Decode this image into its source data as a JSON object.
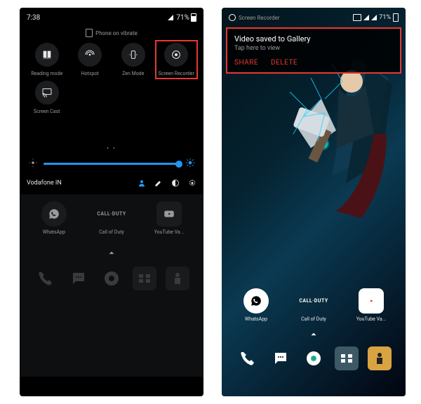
{
  "left": {
    "status": {
      "time": "7:38",
      "battery_pct": "71%"
    },
    "vibrate_label": "Phone on vibrate",
    "tiles": [
      {
        "label": "Reading mode",
        "icon": "book"
      },
      {
        "label": "Hotspot",
        "icon": "hotspot"
      },
      {
        "label": "Zen Mode",
        "icon": "zen"
      },
      {
        "label": "Screen Recorder",
        "icon": "record",
        "highlight": true
      },
      {
        "label": "Screen Cast",
        "icon": "cast"
      }
    ],
    "carrier": "Vodafone IN",
    "apps": [
      {
        "label": "WhatsApp",
        "icon": "whatsapp"
      },
      {
        "label": "Call of Duty",
        "icon": "cod"
      },
      {
        "label": "YouTube Va...",
        "icon": "youtube"
      }
    ],
    "dock": [
      {
        "icon": "phone"
      },
      {
        "icon": "sms"
      },
      {
        "icon": "chrome"
      },
      {
        "icon": "grid"
      },
      {
        "icon": "pubg"
      }
    ]
  },
  "right": {
    "status": {
      "rec_label": "Screen Recorder",
      "battery_pct": "71%"
    },
    "notification": {
      "title": "Video saved to Gallery",
      "subtitle": "Tap here to view",
      "share": "SHARE",
      "delete": "DELETE"
    },
    "apps": [
      {
        "label": "WhatsApp",
        "icon": "whatsapp"
      },
      {
        "label": "Call of Duty",
        "icon": "cod"
      },
      {
        "label": "YouTube Va...",
        "icon": "youtube"
      }
    ],
    "dock": [
      {
        "icon": "phone"
      },
      {
        "icon": "sms"
      },
      {
        "icon": "chrome"
      },
      {
        "icon": "grid"
      },
      {
        "icon": "pubg"
      }
    ]
  }
}
